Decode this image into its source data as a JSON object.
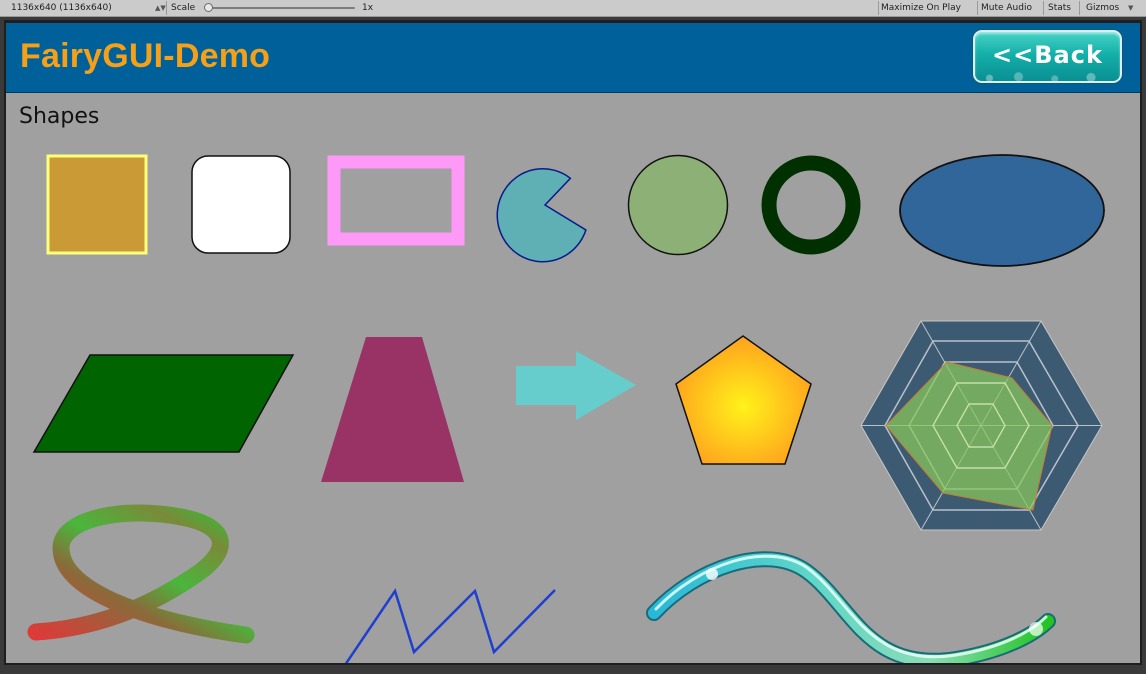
{
  "toolbar": {
    "resolution": "1136x640 (1136x640)",
    "scale_label": "Scale",
    "scale_value": "1x",
    "maximize_on_play": "Maximize On Play",
    "mute_audio": "Mute Audio",
    "stats": "Stats",
    "gizmos": "Gizmos"
  },
  "header": {
    "title": "FairyGUI-Demo",
    "back_label": "<<Back"
  },
  "section": {
    "label": "Shapes"
  },
  "colors": {
    "header_bg": "#00609a",
    "title": "#f6a018",
    "view_bg": "#a0a0a0"
  },
  "shapes": [
    "square",
    "rounded-rect",
    "hollow-rect",
    "pie",
    "circle",
    "ring",
    "ellipse",
    "parallelogram",
    "trapezoid",
    "arrow",
    "pentagon",
    "radar",
    "gradient-line",
    "zigzag-line",
    "textured-line"
  ]
}
